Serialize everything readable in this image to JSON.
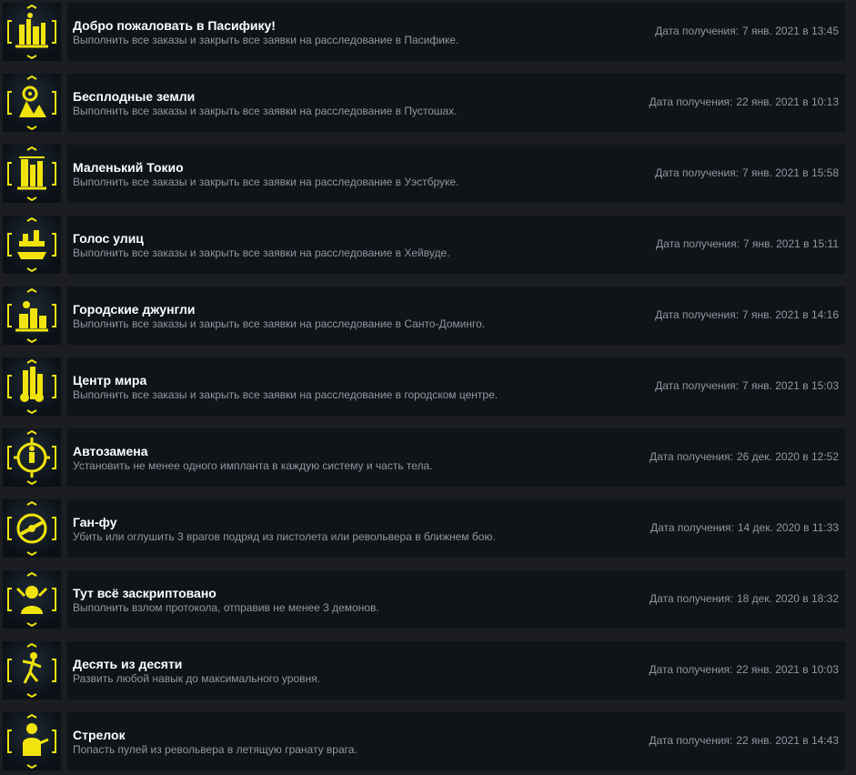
{
  "date_label": "Дата получения:",
  "colors": {
    "page_bg": "#1b1d21",
    "row_bg": "#0f1419",
    "title": "#ffffff",
    "muted": "#8f98a0",
    "icon_yellow": "#f1e40e"
  },
  "achievements": [
    {
      "title": "Добро пожаловать в Пасифику!",
      "description": "Выполнить все заказы и закрыть все заявки на расследование в Пасифике.",
      "date": "7 янв. 2021 в 13:45",
      "icon": "pacifica-district-icon"
    },
    {
      "title": "Бесплодные земли",
      "description": "Выполнить все заказы и закрыть все заявки на расследование в Пустошах.",
      "date": "22 янв. 2021 в 10:13",
      "icon": "badlands-district-icon"
    },
    {
      "title": "Маленький Токио",
      "description": "Выполнить все заказы и закрыть все заявки на расследование в Уэстбруке.",
      "date": "7 янв. 2021 в 15:58",
      "icon": "westbrook-district-icon"
    },
    {
      "title": "Голос улиц",
      "description": "Выполнить все заказы и закрыть все заявки на расследование в Хейвуде.",
      "date": "7 янв. 2021 в 15:11",
      "icon": "heywood-district-icon"
    },
    {
      "title": "Городские джунгли",
      "description": "Выполнить все заказы и закрыть все заявки на расследование в Санто-Доминго.",
      "date": "7 янв. 2021 в 14:16",
      "icon": "santo-domingo-district-icon"
    },
    {
      "title": "Центр мира",
      "description": "Выполнить все заказы и закрыть все заявки на расследование в городском центре.",
      "date": "7 янв. 2021 в 15:03",
      "icon": "city-center-district-icon"
    },
    {
      "title": "Автозамена",
      "description": "Установить не менее одного импланта в каждую систему и часть тела.",
      "date": "26 дек. 2020 в 12:52",
      "icon": "cyberware-body-icon"
    },
    {
      "title": "Ган-фу",
      "description": "Убить или оглушить 3 врагов подряд из пистолета или револьвера в ближнем бою.",
      "date": "14 дек. 2020 в 11:33",
      "icon": "crosshair-icon"
    },
    {
      "title": "Тут всё заскриптовано",
      "description": "Выполнить взлом протокола, отправив не менее 3 демонов.",
      "date": "18 дек. 2020 в 18:32",
      "icon": "hacker-daemon-icon"
    },
    {
      "title": "Десять из десяти",
      "description": "Развить любой навык до максимального уровня.",
      "date": "22 янв. 2021 в 10:03",
      "icon": "skill-figure-icon"
    },
    {
      "title": "Стрелок",
      "description": "Попасть пулей из револьвера в летящую гранату врага.",
      "date": "22 янв. 2021 в 14:43",
      "icon": "gunslinger-icon"
    }
  ]
}
